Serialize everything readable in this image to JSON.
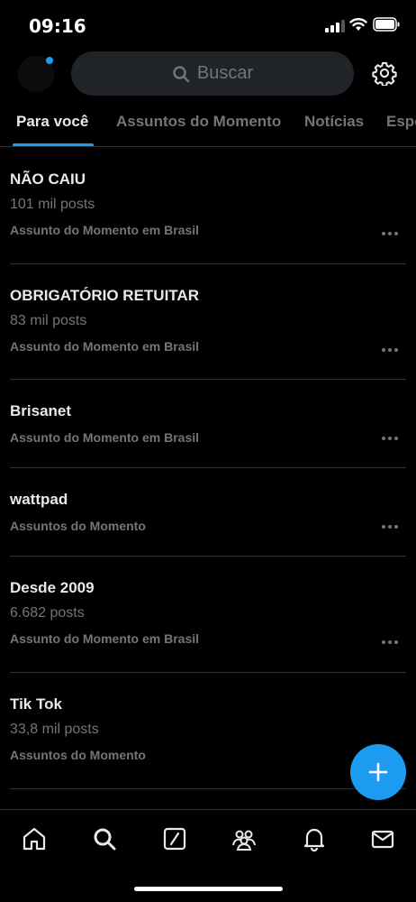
{
  "status_bar": {
    "time": "09:16"
  },
  "search": {
    "label": "Buscar"
  },
  "tabs": [
    {
      "label": "Para você",
      "active": true
    },
    {
      "label": "Assuntos do Momento",
      "active": false
    },
    {
      "label": "Notícias",
      "active": false
    },
    {
      "label": "Esportes",
      "active": false
    }
  ],
  "trends": [
    {
      "title": "NÃO CAIU",
      "count": "101 mil posts",
      "context": "Assunto do Momento em Brasil"
    },
    {
      "title": "OBRIGATÓRIO RETUITAR",
      "count": "83 mil posts",
      "context": "Assunto do Momento em Brasil"
    },
    {
      "title": "Brisanet",
      "count": "",
      "context": "Assunto do Momento em Brasil"
    },
    {
      "title": "wattpad",
      "count": "",
      "context": "Assuntos do Momento"
    },
    {
      "title": "Desde 2009",
      "count": "6.682 posts",
      "context": "Assunto do Momento em Brasil"
    },
    {
      "title": "Tik Tok",
      "count": "33,8 mil posts",
      "context": "Assuntos do Momento"
    }
  ],
  "colors": {
    "accent": "#1d9bf0",
    "background": "#000000",
    "divider": "#2f3336",
    "muted": "#71767b"
  },
  "icons": [
    "search-icon",
    "gear-icon",
    "more-icon",
    "plus-icon",
    "home-icon",
    "grok-icon",
    "communities-icon",
    "notifications-icon",
    "messages-icon"
  ]
}
